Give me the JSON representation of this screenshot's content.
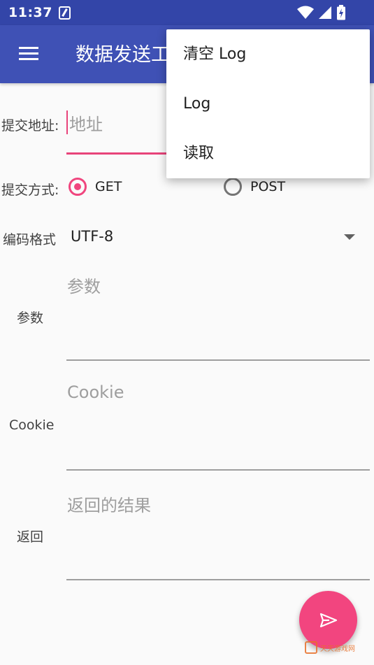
{
  "status_bar": {
    "time": "11:37",
    "icons": [
      "app-notification-icon",
      "wifi-icon",
      "cell-signal-icon",
      "battery-charging-icon"
    ]
  },
  "app_bar": {
    "title": "数据发送工具",
    "menu_icon": "hamburger-menu-icon",
    "color": "#3f51b5"
  },
  "form": {
    "url": {
      "label": "提交地址:",
      "placeholder": "地址"
    },
    "method": {
      "label": "提交方式:",
      "options": [
        {
          "label": "GET",
          "checked": true
        },
        {
          "label": "POST",
          "checked": false
        }
      ]
    },
    "encoding": {
      "label": "编码格式",
      "value": "UTF-8"
    },
    "params": {
      "label": "参数",
      "placeholder": "参数"
    },
    "cookie": {
      "label": "Cookie",
      "placeholder": "Cookie"
    },
    "result": {
      "label": "返回",
      "placeholder": "返回的结果"
    }
  },
  "fab": {
    "icon": "send-icon",
    "color": "#f2457f"
  },
  "overflow_menu": {
    "items": [
      {
        "label": "清空 Log"
      },
      {
        "label": "Log"
      },
      {
        "label": "读取"
      }
    ]
  },
  "watermark": {
    "text": "天天游戏网",
    "sub": "www.ttyl23.com"
  },
  "colors": {
    "accent": "#e8437a",
    "primary_dark": "#3345a8"
  }
}
